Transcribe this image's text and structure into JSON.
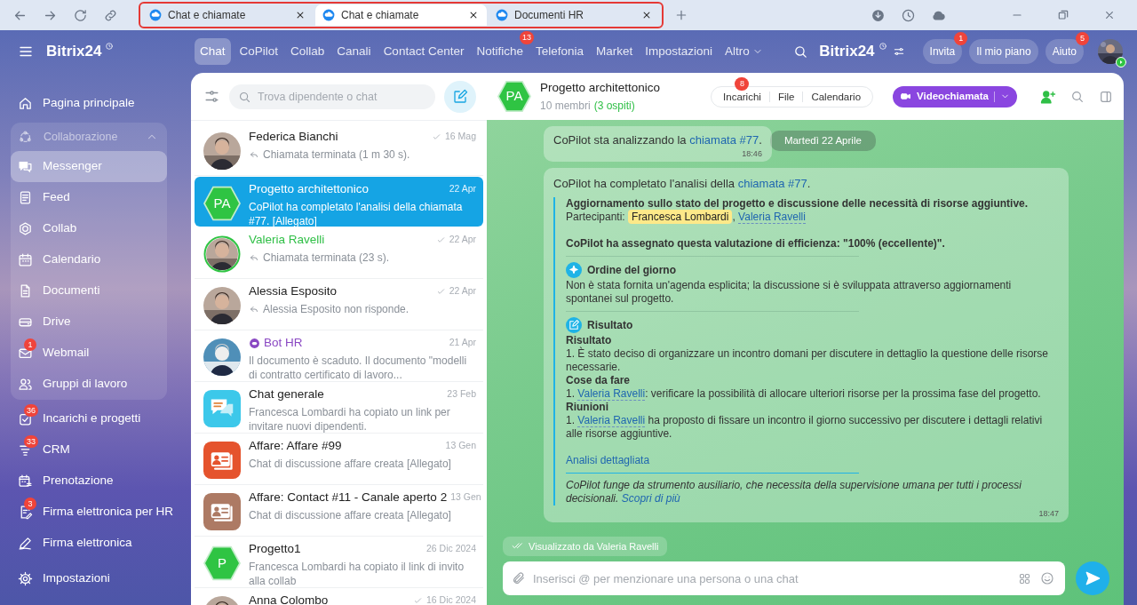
{
  "browser": {
    "tabs": [
      {
        "title": "Chat e chiamate",
        "selected": false
      },
      {
        "title": "Chat e chiamate",
        "selected": true
      },
      {
        "title": "Documenti HR",
        "selected": false
      }
    ]
  },
  "sidebar": {
    "logo": "Bitrix24",
    "items": [
      {
        "kind": "item",
        "label": "Pagina principale",
        "selected": false
      },
      {
        "kind": "group",
        "label": "Collaborazione",
        "expanded": true,
        "children": [
          {
            "label": "Messenger",
            "selected": true
          },
          {
            "label": "Feed",
            "selected": false
          },
          {
            "label": "Collab",
            "selected": false
          },
          {
            "label": "Calendario",
            "selected": false
          },
          {
            "label": "Documenti",
            "selected": false
          },
          {
            "label": "Drive",
            "selected": false
          },
          {
            "label": "Webmail",
            "selected": false,
            "badge": "1"
          },
          {
            "label": "Gruppi di lavoro",
            "selected": false
          }
        ]
      },
      {
        "kind": "item",
        "label": "Incarichi e progetti",
        "selected": false,
        "badge": "36"
      },
      {
        "kind": "item",
        "label": "CRM",
        "selected": false,
        "badge": "33"
      },
      {
        "kind": "item",
        "label": "Prenotazione",
        "selected": false
      },
      {
        "kind": "item",
        "label": "Firma elettronica per HR",
        "selected": false,
        "badge": "3"
      },
      {
        "kind": "item",
        "label": "Firma elettronica",
        "selected": false
      }
    ],
    "footer": "Impostazioni"
  },
  "top_nav": {
    "items": [
      {
        "label": "Chat",
        "selected": true
      },
      {
        "label": "CoPilot",
        "selected": false
      },
      {
        "label": "Collab",
        "selected": false
      },
      {
        "label": "Canali",
        "selected": false
      },
      {
        "label": "Contact Center",
        "selected": false
      },
      {
        "label": "Notifiche",
        "selected": false,
        "badge": "13"
      },
      {
        "label": "Telefonia",
        "selected": false
      },
      {
        "label": "Market",
        "selected": false
      },
      {
        "label": "Impostazioni",
        "selected": false
      },
      {
        "label": "Altro",
        "selected": false,
        "dropdown": true
      }
    ],
    "brand": "Bitrix24",
    "buttons": [
      {
        "label": "Invita",
        "badge": "1"
      },
      {
        "label": "Il mio piano"
      },
      {
        "label": "Aiuto",
        "badge": "5"
      }
    ]
  },
  "chat_list": {
    "search": {
      "placeholder": "Trova dipendente o chat"
    },
    "chats": [
      {
        "kind": "user",
        "name": "Federica Bianchi",
        "time": "16 Mag",
        "preview": "Chiamata terminata (1 m 30 s).",
        "read": true,
        "reply": true,
        "selected": false
      },
      {
        "kind": "user",
        "name": "Progetto architettonico",
        "time": "22 Apr",
        "preview": "CoPilot ha completato l'analisi della chiamata #77. [Allegato]",
        "read": false,
        "reply": false,
        "selected": true,
        "avatar": {
          "kind": "initials",
          "text": "PA",
          "color": "#2fc443"
        }
      },
      {
        "kind": "guest",
        "name": "Valeria Ravelli",
        "time": "22 Apr",
        "preview": "Chiamata terminata (23 s).",
        "read": true,
        "reply": true,
        "selected": false
      },
      {
        "kind": "user",
        "name": "Alessia Esposito",
        "time": "22 Apr",
        "preview": "Alessia Esposito non risponde.",
        "read": true,
        "reply": true,
        "selected": false
      },
      {
        "kind": "bot",
        "name": "Bot HR",
        "time": "21 Apr",
        "preview": "Il documento è scaduto. Il documento \"modelli di contratto certificato di lavoro...",
        "read": false,
        "reply": false,
        "selected": false
      },
      {
        "kind": "user",
        "name": "Chat generale",
        "time": "23 Feb",
        "preview": "Francesca Lombardi ha copiato un link per invitare nuovi dipendenti.",
        "read": false,
        "reply": false,
        "selected": false,
        "avatar": {
          "kind": "chat",
          "color": "#3cc8ea"
        }
      },
      {
        "kind": "user",
        "name": "Affare: Affare #99",
        "time": "13 Gen",
        "preview": "Chat di discussione affare creata [Allegato]",
        "read": false,
        "reply": false,
        "selected": false,
        "avatar": {
          "kind": "deal",
          "color": "#e5532d"
        }
      },
      {
        "kind": "user",
        "name": "Affare: Contact #11 - Canale aperto 2",
        "time": "13 Gen",
        "preview": "Chat di discussione affare creata [Allegato]",
        "read": false,
        "reply": false,
        "selected": false,
        "avatar": {
          "kind": "deal",
          "color": "#ad7a64"
        }
      },
      {
        "kind": "user",
        "name": "Progetto1",
        "time": "26 Dic 2024",
        "preview": "Francesca Lombardi ha copiato il link di invito alla collab",
        "read": false,
        "reply": false,
        "selected": false,
        "avatar": {
          "kind": "initials",
          "text": "P",
          "color": "#2fc443"
        }
      },
      {
        "kind": "user",
        "name": "Anna Colombo",
        "time": "16 Dic 2024",
        "read": true,
        "selected": false
      }
    ]
  },
  "chat": {
    "avatar": {
      "kind": "initials",
      "text": "PA",
      "color": "#2fc443"
    },
    "title": "Progetto architettonico",
    "members": "10 membri",
    "guests": "(3 ospiti)",
    "tabs": [
      {
        "label": "Incarichi",
        "badge": "8"
      },
      {
        "label": "File"
      },
      {
        "label": "Calendario"
      }
    ],
    "call_button": "Videochiamata",
    "date_divider": "Martedì 22 Aprile",
    "messages": [
      {
        "kind": "status",
        "parts": [
          {
            "kind": "text",
            "text": "CoPilot sta analizzando la "
          },
          {
            "kind": "link",
            "text": "chiamata #77"
          },
          {
            "kind": "text",
            "text": "."
          }
        ],
        "time": "18:46"
      },
      {
        "kind": "report",
        "parts": [
          {
            "kind": "text",
            "text": "CoPilot ha completato l'analisi della "
          },
          {
            "kind": "link",
            "text": "chiamata #77"
          },
          {
            "kind": "text",
            "text": "."
          }
        ],
        "time": "18:47",
        "report": {
          "title": "Aggiornamento sullo stato del progetto e discussione delle necessità di risorse aggiuntive.",
          "participants": [
            {
              "kind": "text",
              "text": "Partecipanti: "
            },
            {
              "kind": "highlight",
              "text": "Francesca Lombardi"
            },
            {
              "kind": "text",
              "text": ", "
            },
            {
              "kind": "mention",
              "text": "Valeria Ravelli"
            }
          ],
          "efficiency": "CoPilot ha assegnato questa valutazione di efficienza: \"100% (eccellente)\".",
          "sections": [
            {
              "kind": "agenda",
              "title": "Ordine del giorno",
              "blocks": [
                {
                  "kind": "text",
                  "parts": [
                    {
                      "kind": "text",
                      "text": "Non è stata fornita un'agenda esplicita; la discussione si è sviluppata attraverso aggiornamenti spontanei sul progetto."
                    }
                  ]
                }
              ]
            },
            {
              "kind": "result",
              "title": "Risultato",
              "blocks": [
                {
                  "kind": "heading",
                  "parts": [
                    {
                      "kind": "text",
                      "text": "Risultato"
                    }
                  ]
                },
                {
                  "kind": "text",
                  "parts": [
                    {
                      "kind": "text",
                      "text": "1. È stato deciso di organizzare un incontro domani per discutere in dettaglio la questione delle risorse necessarie."
                    }
                  ]
                },
                {
                  "kind": "heading",
                  "parts": [
                    {
                      "kind": "text",
                      "text": "Cose da fare"
                    }
                  ]
                },
                {
                  "kind": "text",
                  "parts": [
                    {
                      "kind": "text",
                      "text": "1. "
                    },
                    {
                      "kind": "mention",
                      "text": "Valeria Ravelli"
                    },
                    {
                      "kind": "text",
                      "text": ": verificare la possibilità di allocare ulteriori risorse per la prossima fase del progetto."
                    }
                  ]
                },
                {
                  "kind": "heading",
                  "parts": [
                    {
                      "kind": "text",
                      "text": "Riunioni"
                    }
                  ]
                },
                {
                  "kind": "text",
                  "parts": [
                    {
                      "kind": "text",
                      "text": "1. "
                    },
                    {
                      "kind": "mention",
                      "text": "Valeria Ravelli"
                    },
                    {
                      "kind": "text",
                      "text": " ha proposto di fissare un incontro il giorno successivo per discutere i dettagli relativi alle risorse aggiuntive."
                    }
                  ]
                }
              ]
            }
          ],
          "details_link": "Analisi dettagliata",
          "disclaimer": [
            {
              "kind": "text",
              "text": "CoPilot funge da strumento ausiliario, che necessita della supervisione umana per tutti i processi decisionali. "
            },
            {
              "kind": "link",
              "text": "Scopri di più"
            }
          ]
        }
      }
    ],
    "seen": "Visualizzato da Valeria Ravelli",
    "composer": {
      "placeholder": "Inserisci @ per menzionare una persona o una chat"
    }
  }
}
